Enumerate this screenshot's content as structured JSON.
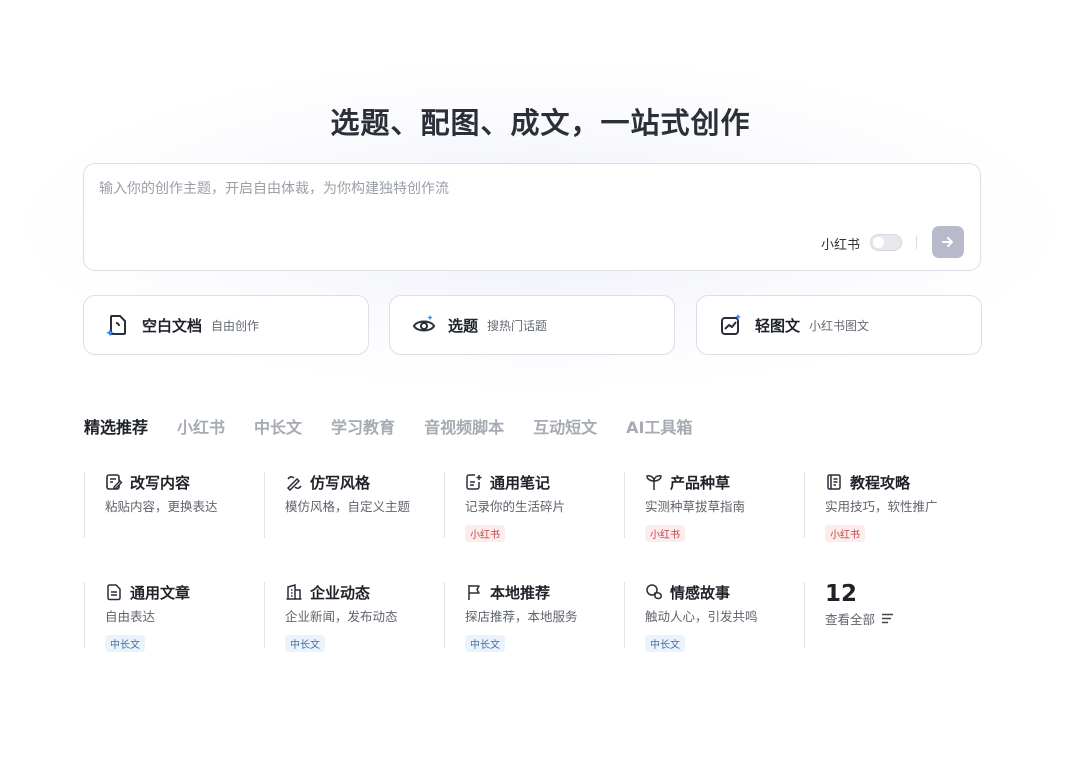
{
  "hero": {
    "title": "选题、配图、成文，一站式创作"
  },
  "composer": {
    "placeholder": "输入你的创作主题，开启自由体裁，为你构建独特创作流",
    "xhs_toggle_label": "小红书"
  },
  "quick_actions": [
    {
      "title": "空白文档",
      "subtitle": "自由创作",
      "icon": "blank-doc-icon"
    },
    {
      "title": "选题",
      "subtitle": "搜热门话题",
      "icon": "eye-icon"
    },
    {
      "title": "轻图文",
      "subtitle": "小红书图文",
      "icon": "chart-sparkle-icon"
    }
  ],
  "tabs": [
    "精选推荐",
    "小红书",
    "中长文",
    "学习教育",
    "音视频脚本",
    "互动短文",
    "AI工具箱"
  ],
  "templates": [
    {
      "title": "改写内容",
      "desc": "粘贴内容，更换表达",
      "tag": "",
      "icon": "edit-doc-icon"
    },
    {
      "title": "仿写风格",
      "desc": "模仿风格，自定义主题",
      "tag": "",
      "icon": "pen-style-icon"
    },
    {
      "title": "通用笔记",
      "desc": "记录你的生活碎片",
      "tag": "小红书",
      "icon": "note-plus-icon"
    },
    {
      "title": "产品种草",
      "desc": "实测种草拔草指南",
      "tag": "小红书",
      "icon": "sprout-icon"
    },
    {
      "title": "教程攻略",
      "desc": "实用技巧，软性推广",
      "tag": "小红书",
      "icon": "book-icon"
    },
    {
      "title": "通用文章",
      "desc": "自由表达",
      "tag": "中长文",
      "icon": "article-icon"
    },
    {
      "title": "企业动态",
      "desc": "企业新闻，发布动态",
      "tag": "中长文",
      "icon": "building-icon"
    },
    {
      "title": "本地推荐",
      "desc": "探店推荐，本地服务",
      "tag": "中长文",
      "icon": "flag-icon"
    },
    {
      "title": "情感故事",
      "desc": "触动人心，引发共鸣",
      "tag": "中长文",
      "icon": "heart-chat-icon"
    }
  ],
  "more": {
    "count": "12",
    "label": "查看全部"
  }
}
